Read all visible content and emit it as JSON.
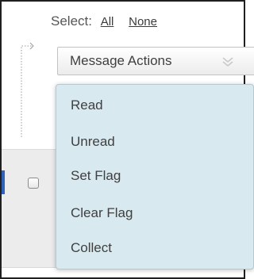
{
  "select": {
    "label": "Select:",
    "all_label": "All",
    "none_label": "None"
  },
  "actions": {
    "button_label": "Message Actions",
    "chevron_icon": "double-chevron-down-icon"
  },
  "menu": {
    "items": [
      {
        "label": "Read"
      },
      {
        "label": "Unread"
      },
      {
        "label": "Set Flag"
      },
      {
        "label": "Clear Flag"
      },
      {
        "label": "Collect"
      }
    ]
  },
  "colors": {
    "menu_background": "#d8e9f0",
    "selected_row_marker": "#2f62b8",
    "background_band": "#ececec"
  }
}
